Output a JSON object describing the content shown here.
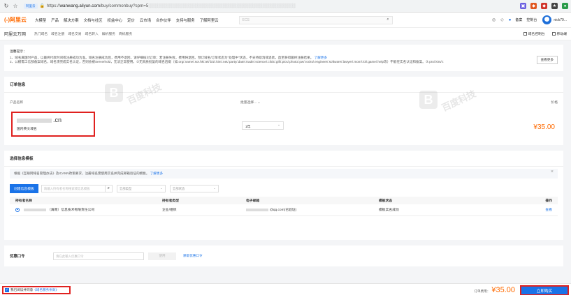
{
  "browser": {
    "nav_icons": [
      "←→",
      "☆"
    ],
    "ext_tag": "阿里云",
    "url_prefix": "https://",
    "url_host": "wanwang.aliyun.com",
    "url_path": "/buy/commonbuy?spm=5",
    "toolbar_icons": [
      "extension-icon",
      "bookmark-icon",
      "profile-icon"
    ]
  },
  "topnav": {
    "logo": "(-)阿里云",
    "items": [
      "大模型",
      "产品",
      "解决方案",
      "文档与社区",
      "权益中心",
      "定价",
      "云市场",
      "合作伙伴",
      "支持与服务",
      "了解阿里云"
    ],
    "search_placeholder": "ECS",
    "right_items": [
      "备案",
      "控制台"
    ],
    "username": "nick79..."
  },
  "subnav": {
    "brand": "阿里云万网",
    "items": [
      "热门域名",
      "域名注册",
      "域名交易",
      "域名转入",
      "解析服务",
      "商标服务"
    ],
    "right_links": [
      "域名控制台",
      "移动端"
    ]
  },
  "notice": {
    "title": "温馨提示：",
    "line1": "1、域名属国时产品，以最终付款时间或注册成功为准。域名注册成功后，费用不退回，请仔细核对订单；若注册失败，费用将退回。预订域名/订单状态为\"处理中\"状态，不支持取消或退款，直至获得最终注册结果。",
    "line1_link": "了解更多",
    "line2": "2、公模需工信部备案域名，域名须完成实名认证，否则会被Serverhold，无法正常使用。②无资质批复的域名后缀（如.org/.name/.sor.hk/.tel/.biz/.kim/.net/.party/.date/.trade/.science/.click/.gift/.pics/.photo/.pw/.rocks/.engineer/.software/.lawyer/.mom/.lol/.game/.help等）不能在实名认证和备案。③.pro/.kim/.t",
    "more_button": "查看更多"
  },
  "order": {
    "section_title": "订单信息",
    "col_product": "产品名称",
    "col_period": "批量选择...",
    "col_price": "价格",
    "domain_suffix": ".cn",
    "domain_type": "国内英文域名",
    "period": "1年",
    "price": "¥35.00"
  },
  "holder": {
    "section_title": "选择信息模板",
    "tip": "根据《互联网域名管理办法》及ICANN政策要求，注册域名需使用实名并完成邮箱验证的模板。",
    "tip_link": "了解更多",
    "create_button": "创建信息模板",
    "search_placeholder": "请输入持有者名称搜索或信息模板",
    "filter_type": "全部类型",
    "filter_status": "全部状态",
    "columns": [
      "持有者名称",
      "持有者类型",
      "电子邮箱",
      "模板状态",
      "操作"
    ],
    "rows": [
      {
        "name": "（海南）信息技术有限责任公司",
        "type": "企业/组织",
        "email": "@qq.com(已验证)",
        "status": "模板实名成功",
        "action": "查看"
      }
    ]
  },
  "coupon": {
    "label": "优惠口令",
    "placeholder": "请在此输入优惠口令",
    "use_button": "使用",
    "get_link": "获取优惠口令"
  },
  "footer": {
    "agree_text": "我已阅读并同意",
    "agree_link": "《域名服务条款》",
    "cost_label": "订单费用：",
    "cost_value": "¥35.00",
    "buy_button": "立即购买"
  },
  "watermark": {
    "text": "百度科技"
  },
  "colors": {
    "brand_orange": "#ff6a00",
    "primary_blue": "#1a73e8",
    "highlight_red": "#e0211f"
  }
}
